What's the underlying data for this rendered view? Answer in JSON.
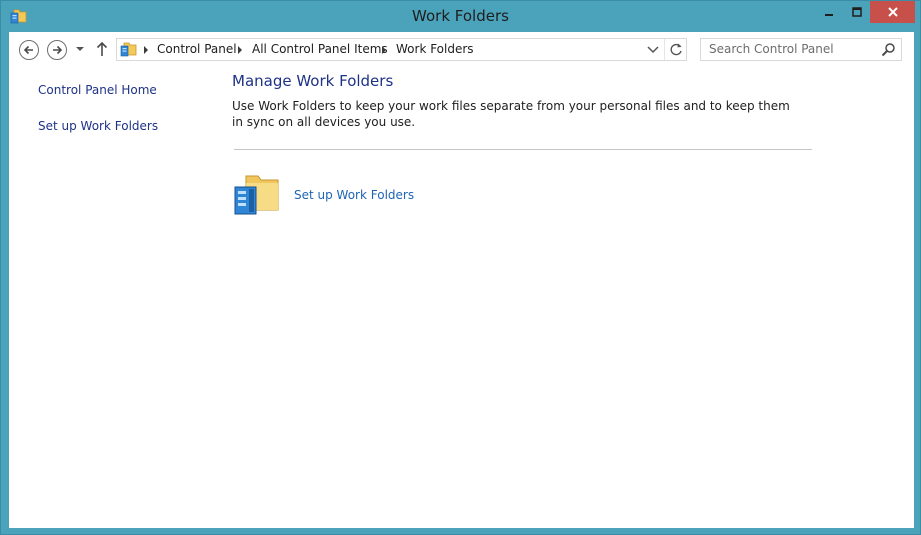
{
  "window": {
    "title": "Work Folders",
    "accent_color": "#4ba3bb",
    "close_color": "#c7504b",
    "app_icon": "work-folders-icon"
  },
  "navigation": {
    "back_icon": "back-arrow-icon",
    "forward_icon": "forward-arrow-icon",
    "recent_icon": "chevron-down-icon",
    "up_icon": "up-arrow-icon"
  },
  "address_bar": {
    "breadcrumbs": [
      "Control Panel",
      "All Control Panel Items",
      "Work Folders"
    ],
    "location_icon": "control-panel-icon",
    "dropdown_icon": "chevron-down-icon",
    "refresh_icon": "refresh-icon"
  },
  "search": {
    "placeholder": "Search Control Panel",
    "icon": "search-icon"
  },
  "sidebar": {
    "items": [
      {
        "label": "Control Panel Home"
      },
      {
        "label": "Set up Work Folders"
      }
    ]
  },
  "main": {
    "title": "Manage Work Folders",
    "description": "Use Work Folders to keep your work files separate from your personal files and to keep them in sync on all devices you use.",
    "task": {
      "label": "Set up Work Folders",
      "icon": "work-folders-icon",
      "link_color": "#1e64b4"
    },
    "title_color": "#1e3287"
  }
}
